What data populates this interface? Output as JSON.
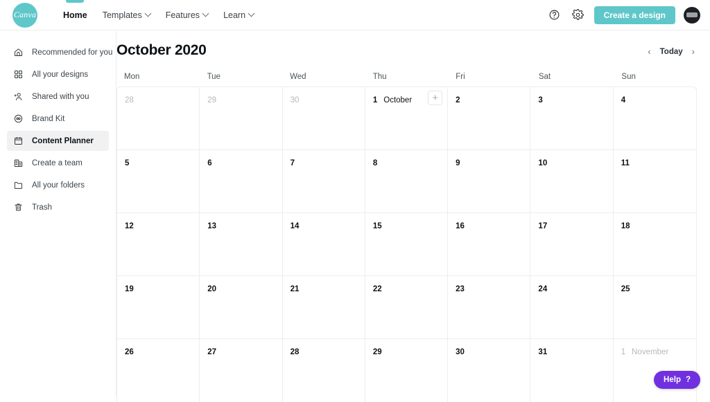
{
  "brand": {
    "logo_text": "Canva",
    "teal": "#5fc7ca",
    "purple": "#7030e0"
  },
  "topnav": {
    "items": [
      {
        "label": "Home",
        "icon": "",
        "has_chevron": false,
        "active": true
      },
      {
        "label": "Templates",
        "icon": "chevron-down-icon",
        "has_chevron": true,
        "active": false
      },
      {
        "label": "Features",
        "icon": "chevron-down-icon",
        "has_chevron": true,
        "active": false
      },
      {
        "label": "Learn",
        "icon": "chevron-down-icon",
        "has_chevron": true,
        "active": false
      }
    ],
    "help_icon": "question-circle-icon",
    "settings_icon": "gear-icon",
    "cta_label": "Create a design",
    "avatar_label": "user-avatar"
  },
  "sidebar": {
    "items": [
      {
        "label": "Recommended for you",
        "icon": "home-icon",
        "active": false
      },
      {
        "label": "All your designs",
        "icon": "grid-icon",
        "active": false
      },
      {
        "label": "Shared with you",
        "icon": "add-person-icon",
        "active": false
      },
      {
        "label": "Brand Kit",
        "icon": "brand-kit-icon",
        "active": false
      },
      {
        "label": "Content Planner",
        "icon": "calendar-icon",
        "active": true
      },
      {
        "label": "Create a team",
        "icon": "team-building-icon",
        "active": false
      },
      {
        "label": "All your folders",
        "icon": "folder-icon",
        "active": false
      },
      {
        "label": "Trash",
        "icon": "trash-icon",
        "active": false
      }
    ]
  },
  "calendar": {
    "title": "October 2020",
    "prev_label": "‹",
    "today_label": "Today",
    "next_label": "›",
    "day_headers": [
      "Mon",
      "Tue",
      "Wed",
      "Thu",
      "Fri",
      "Sat",
      "Sun"
    ],
    "weeks": [
      [
        {
          "day": "28",
          "muted": true,
          "month": "",
          "add": false
        },
        {
          "day": "29",
          "muted": true,
          "month": "",
          "add": false
        },
        {
          "day": "30",
          "muted": true,
          "month": "",
          "add": false
        },
        {
          "day": "1",
          "muted": false,
          "month": "October",
          "add": true
        },
        {
          "day": "2",
          "muted": false,
          "month": "",
          "add": false
        },
        {
          "day": "3",
          "muted": false,
          "month": "",
          "add": false
        },
        {
          "day": "4",
          "muted": false,
          "month": "",
          "add": false
        }
      ],
      [
        {
          "day": "5",
          "muted": false,
          "month": "",
          "add": false
        },
        {
          "day": "6",
          "muted": false,
          "month": "",
          "add": false
        },
        {
          "day": "7",
          "muted": false,
          "month": "",
          "add": false
        },
        {
          "day": "8",
          "muted": false,
          "month": "",
          "add": false
        },
        {
          "day": "9",
          "muted": false,
          "month": "",
          "add": false
        },
        {
          "day": "10",
          "muted": false,
          "month": "",
          "add": false
        },
        {
          "day": "11",
          "muted": false,
          "month": "",
          "add": false
        }
      ],
      [
        {
          "day": "12",
          "muted": false,
          "month": "",
          "add": false
        },
        {
          "day": "13",
          "muted": false,
          "month": "",
          "add": false
        },
        {
          "day": "14",
          "muted": false,
          "month": "",
          "add": false
        },
        {
          "day": "15",
          "muted": false,
          "month": "",
          "add": false
        },
        {
          "day": "16",
          "muted": false,
          "month": "",
          "add": false
        },
        {
          "day": "17",
          "muted": false,
          "month": "",
          "add": false
        },
        {
          "day": "18",
          "muted": false,
          "month": "",
          "add": false
        }
      ],
      [
        {
          "day": "19",
          "muted": false,
          "month": "",
          "add": false
        },
        {
          "day": "20",
          "muted": false,
          "month": "",
          "add": false
        },
        {
          "day": "21",
          "muted": false,
          "month": "",
          "add": false
        },
        {
          "day": "22",
          "muted": false,
          "month": "",
          "add": false
        },
        {
          "day": "23",
          "muted": false,
          "month": "",
          "add": false
        },
        {
          "day": "24",
          "muted": false,
          "month": "",
          "add": false
        },
        {
          "day": "25",
          "muted": false,
          "month": "",
          "add": false
        }
      ],
      [
        {
          "day": "26",
          "muted": false,
          "month": "",
          "add": false
        },
        {
          "day": "27",
          "muted": false,
          "month": "",
          "add": false
        },
        {
          "day": "28",
          "muted": false,
          "month": "",
          "add": false
        },
        {
          "day": "29",
          "muted": false,
          "month": "",
          "add": false
        },
        {
          "day": "30",
          "muted": false,
          "month": "",
          "add": false
        },
        {
          "day": "31",
          "muted": false,
          "month": "",
          "add": false
        },
        {
          "day": "1",
          "muted": true,
          "month": "November",
          "add": false
        }
      ]
    ],
    "add_button_label": "+"
  },
  "help_widget": {
    "label": "Help",
    "icon_label": "?"
  }
}
